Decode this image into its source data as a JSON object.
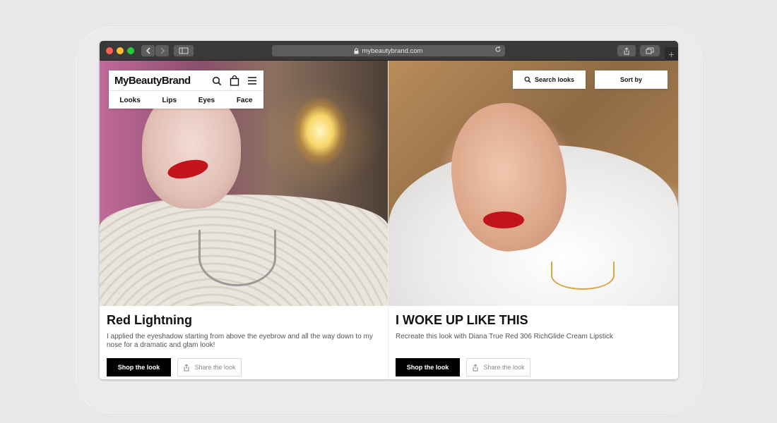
{
  "browser": {
    "url": "mybeautybrand.com",
    "icons": {
      "back": "chevron-left-icon",
      "forward": "chevron-right-icon",
      "sidebar": "sidebar-icon",
      "lock": "lock-icon",
      "reload": "reload-icon",
      "share": "share-icon",
      "tabs": "tabs-icon",
      "new_tab": "plus-icon"
    }
  },
  "brand": {
    "name": "MyBeautyBrand",
    "nav": [
      "Looks",
      "Lips",
      "Eyes",
      "Face"
    ]
  },
  "toolbar": {
    "search_label": "Search looks",
    "sort_label": "Sort by"
  },
  "looks": [
    {
      "title": "Red Lightning",
      "description": "I applied the eyeshadow starting from above the eyebrow and all the way down to my nose for a dramatic and glam look!",
      "shop_label": "Shop the look",
      "share_label": "Share the look"
    },
    {
      "title": "I WOKE UP LIKE THIS",
      "description": "Recreate this look with Diana True Red 306 RichGlide Cream Lipstick",
      "shop_label": "Shop the look",
      "share_label": "Share the look"
    }
  ],
  "colors": {
    "accent": "#000000",
    "lipstick": "#c1141d",
    "titlebar": "#3a3838"
  }
}
